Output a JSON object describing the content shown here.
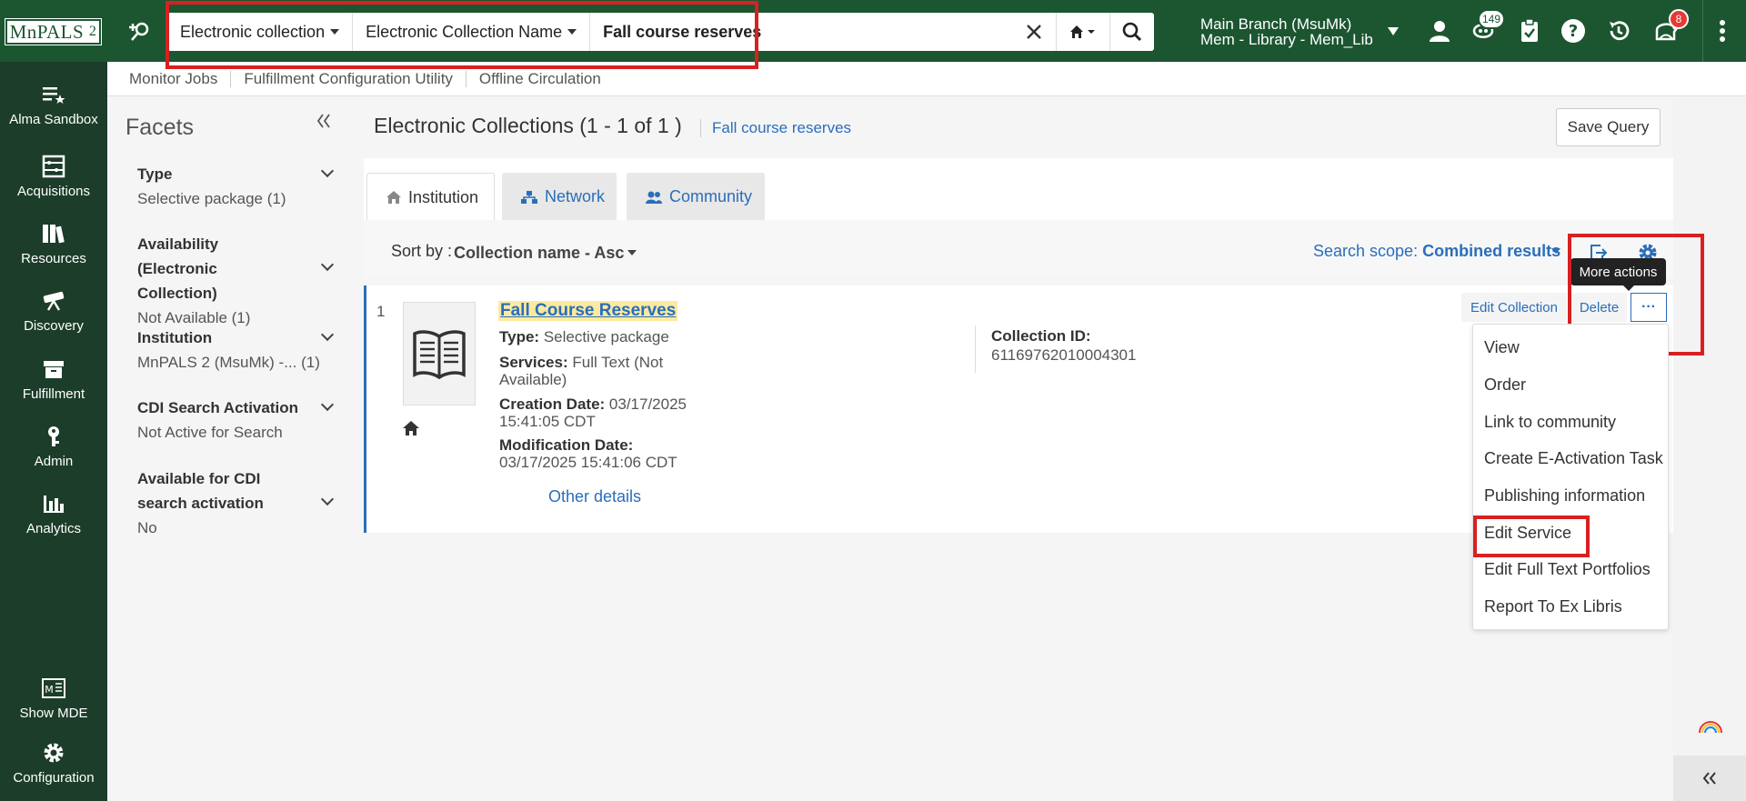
{
  "topbar": {
    "logo_main": "MnPALS",
    "logo_num": "2",
    "search": {
      "type": "Electronic collection",
      "field": "Electronic Collection Name",
      "query": "Fall course reserves"
    },
    "branch_line1": "Main Branch (MsuMk)",
    "branch_line2": "Mem - Library - Mem_Lib",
    "badge_tasks": "149",
    "badge_notifications": "8"
  },
  "sidebar": {
    "items": [
      {
        "label": "Alma Sandbox",
        "icon": "list-star-icon"
      },
      {
        "label": "Acquisitions",
        "icon": "abacus-icon"
      },
      {
        "label": "Resources",
        "icon": "books-icon"
      },
      {
        "label": "Discovery",
        "icon": "telescope-icon"
      },
      {
        "label": "Fulfillment",
        "icon": "box-icon"
      },
      {
        "label": "Admin",
        "icon": "key-icon"
      },
      {
        "label": "Analytics",
        "icon": "bar-chart-icon"
      },
      {
        "label": "Show MDE",
        "icon": "mde-icon"
      },
      {
        "label": "Configuration",
        "icon": "gear-icon"
      }
    ]
  },
  "subnav": [
    "Monitor Jobs",
    "Fulfillment Configuration Utility",
    "Offline Circulation"
  ],
  "facets": {
    "title": "Facets",
    "groups": [
      {
        "title": "Type",
        "value": "Selective package (1)"
      },
      {
        "title": "Availability (Electronic Collection)",
        "value": "Not Available (1)"
      },
      {
        "title": "Institution",
        "value": "MnPALS 2 (MsuMk) -... (1)"
      },
      {
        "title": "CDI Search Activation",
        "value": "Not Active for Search"
      },
      {
        "title": "Available for CDI search activation",
        "value": "No"
      }
    ]
  },
  "results": {
    "title": "Electronic Collections (1 - 1 of 1 )",
    "query_link": "Fall course reserves",
    "save_query": "Save Query",
    "tabs": [
      "Institution",
      "Network",
      "Community"
    ],
    "sort_label": "Sort by :",
    "sort_value": "Collection name - Asc",
    "scope_label": "Search scope:",
    "scope_value": "Combined results",
    "tooltip": "More actions"
  },
  "record": {
    "number": "1",
    "title": "Fall Course Reserves",
    "type_label": "Type:",
    "type_value": "Selective package",
    "services_label": "Services:",
    "services_value_1": "Full Text (Not",
    "services_value_2": "Available)",
    "creation_label": "Creation Date:",
    "creation_value_1": "03/17/2025",
    "creation_value_2": "15:41:05 CDT",
    "modification_label": "Modification Date:",
    "modification_value": "03/17/2025 15:41:06 CDT",
    "other_details": "Other details",
    "collection_id_label": "Collection ID:",
    "collection_id_value": "61169762010004301",
    "edit_collection": "Edit Collection",
    "delete": "Delete",
    "more": "···"
  },
  "dropdown": [
    "View",
    "Order",
    "Link to community",
    "Create E-Activation Task",
    "Publishing information",
    "Edit Service",
    "Edit Full Text Portfolios",
    "Report To Ex Libris"
  ],
  "colors": {
    "topbar": "#1c5631",
    "sidebar": "#1c3d2a",
    "link": "#2a6ebb",
    "highlight": "#d92020"
  }
}
